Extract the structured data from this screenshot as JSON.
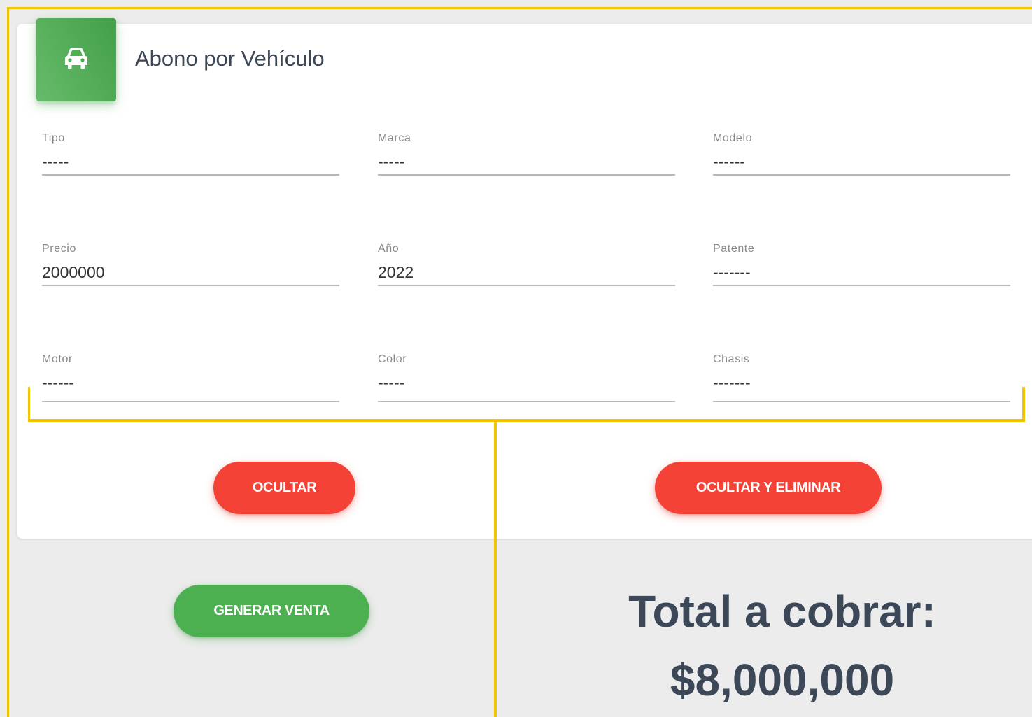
{
  "card": {
    "title": "Abono por Vehículo",
    "icon": "car-icon"
  },
  "fields": {
    "tipo": {
      "label": "Tipo",
      "value": "-----"
    },
    "marca": {
      "label": "Marca",
      "value": "-----"
    },
    "modelo": {
      "label": "Modelo",
      "value": "------"
    },
    "precio": {
      "label": "Precio",
      "value": "2000000"
    },
    "anio": {
      "label": "Año",
      "value": "2022"
    },
    "patente": {
      "label": "Patente",
      "value": "-------"
    },
    "motor": {
      "label": "Motor",
      "value": "------"
    },
    "color": {
      "label": "Color",
      "value": "-----"
    },
    "chasis": {
      "label": "Chasis",
      "value": "-------"
    }
  },
  "actions": {
    "ocultar": "OCULTAR",
    "ocultar_eliminar": "OCULTAR Y ELIMINAR",
    "generar_venta": "GENERAR VENTA"
  },
  "total": {
    "label": "Total a cobrar:",
    "value": "$8,000,000"
  },
  "colors": {
    "accent_green": "#4caf50",
    "accent_red": "#f44336",
    "highlight": "#f2c400"
  }
}
